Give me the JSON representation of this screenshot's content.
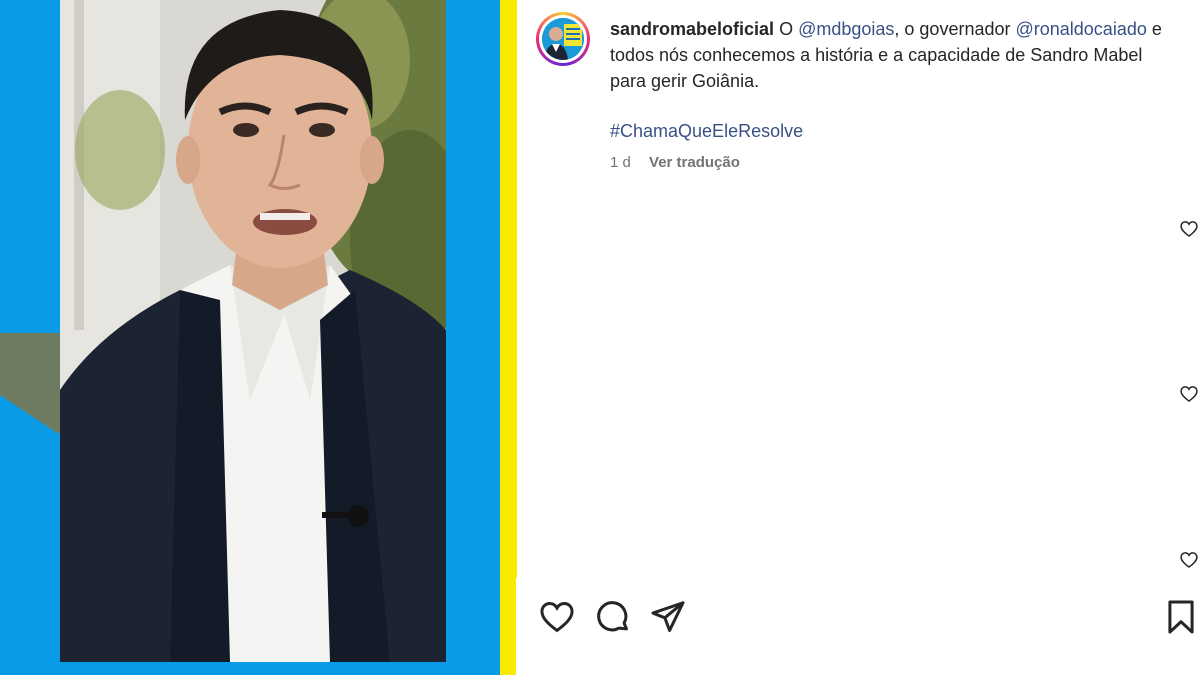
{
  "post": {
    "username": "sandromabeloficial",
    "caption_prefix": " O ",
    "mention_1": "@mdbgoias",
    "caption_mid_1": ", o governador ",
    "mention_2": "@ronaldocaiado",
    "caption_mid_2": " e todos nós conhecemos a história e a capacidade de Sandro Mabel para gerir Goiânia.",
    "hashtag": "#ChamaQueEleResolve",
    "time_ago": "1 d",
    "translate_label": "Ver tradução"
  },
  "icons": {
    "like": "heart-icon",
    "comment": "comment-icon",
    "share": "send-icon",
    "save": "bookmark-icon"
  },
  "colors": {
    "brand_blue": "#0a9be6",
    "brand_yellow": "#f7ec00",
    "link": "#385185",
    "text": "#262626",
    "muted": "#737373"
  }
}
